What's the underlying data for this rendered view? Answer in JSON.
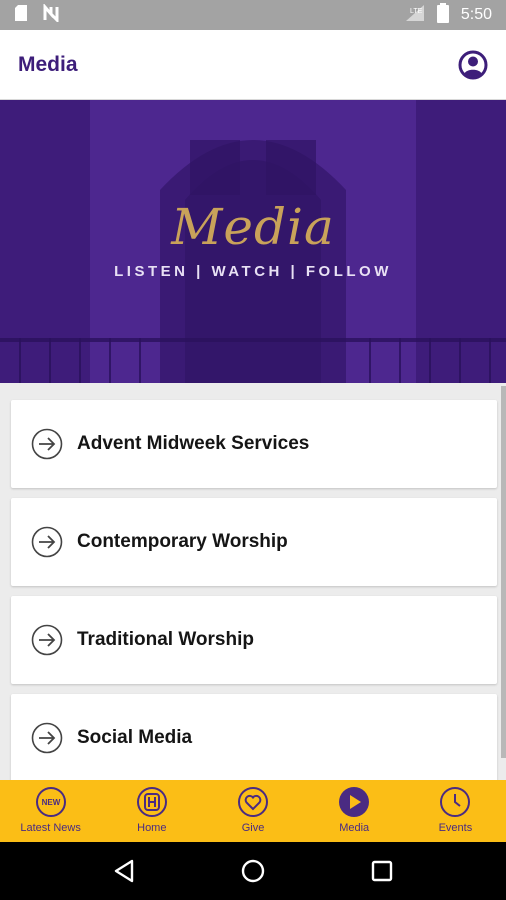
{
  "status_bar": {
    "time": "5:50",
    "icons": [
      "sd-card-icon",
      "no-sim-icon",
      "signal-icon",
      "battery-icon"
    ]
  },
  "app_bar": {
    "title": "Media",
    "account_icon": "account-circle-icon"
  },
  "hero": {
    "title": "Media",
    "tagline": "LISTEN | WATCH | FOLLOW"
  },
  "list": {
    "items": [
      {
        "label": "Advent Midweek Services",
        "icon": "arrow-circle-icon"
      },
      {
        "label": "Contemporary Worship",
        "icon": "arrow-circle-icon"
      },
      {
        "label": "Traditional Worship",
        "icon": "arrow-circle-icon"
      },
      {
        "label": "Social Media",
        "icon": "arrow-circle-icon"
      }
    ]
  },
  "tabbar": {
    "active": "Media",
    "tabs": [
      {
        "label": "Latest News",
        "icon": "new-badge-icon"
      },
      {
        "label": "Home",
        "icon": "home-h-icon"
      },
      {
        "label": "Give",
        "icon": "heart-icon"
      },
      {
        "label": "Media",
        "icon": "play-icon"
      },
      {
        "label": "Events",
        "icon": "clock-icon"
      }
    ]
  },
  "nav_bar": {
    "buttons": [
      "back-icon",
      "home-icon",
      "recents-icon"
    ]
  },
  "colors": {
    "brand_purple": "#3d1e7a",
    "hero_purple": "#4a2488",
    "gold_text": "#c9a25a",
    "tab_yellow": "#fbbe16"
  }
}
